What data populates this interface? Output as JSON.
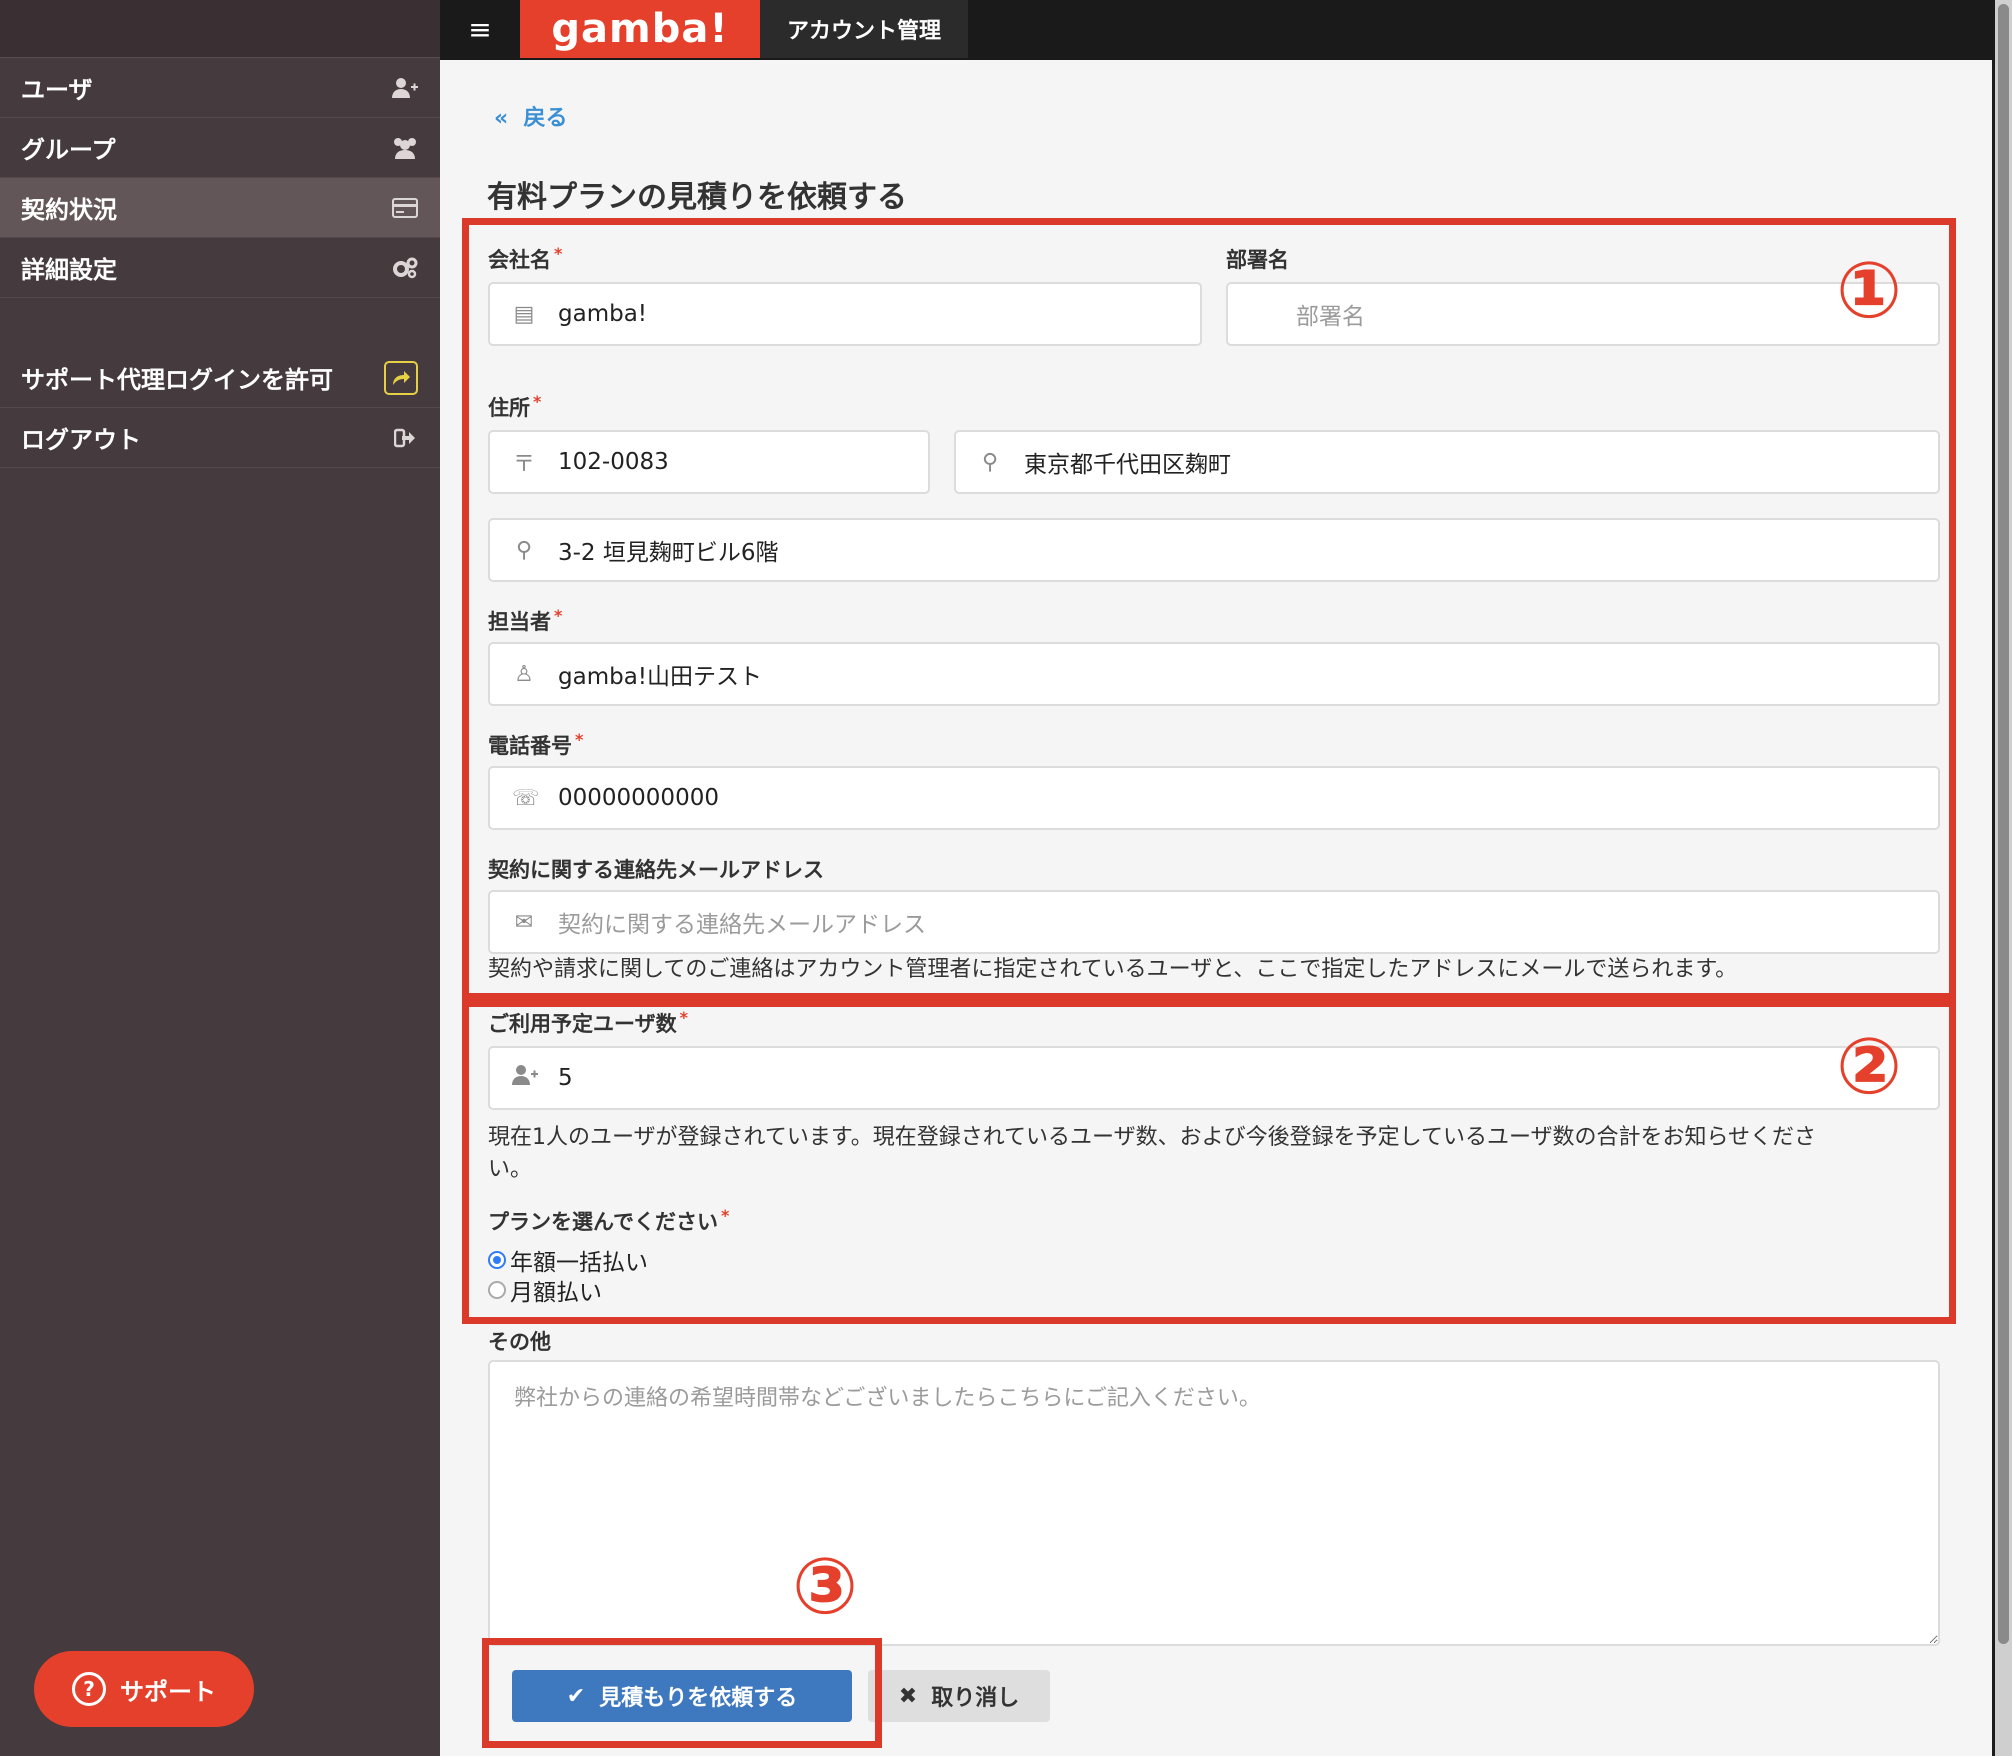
{
  "app": {
    "logo": "gamba!",
    "page_tab": "アカウント管理",
    "menu_icon": "hamburger-icon"
  },
  "sidebar": {
    "items": [
      {
        "label": "ユーザ",
        "icon": "add-user-icon"
      },
      {
        "label": "グループ",
        "icon": "group-icon"
      },
      {
        "label": "契約状況",
        "icon": "credit-card-icon",
        "active": true
      },
      {
        "label": "詳細設定",
        "icon": "gears-icon"
      },
      {
        "label": "サポート代理ログインを許可",
        "icon": "share-icon"
      },
      {
        "label": "ログアウト",
        "icon": "logout-icon"
      }
    ],
    "support_button": "サポート"
  },
  "back_link": "戻る",
  "page_title": "有料プランの見積りを依頼する",
  "form": {
    "company_label": "会社名",
    "company_value": "gamba!",
    "department_label": "部署名",
    "department_placeholder": "部署名",
    "address_label": "住所",
    "postal_value": "102-0083",
    "address1_value": "東京都千代田区麹町",
    "address2_value": "3-2 垣見麹町ビル6階",
    "contact_label": "担当者",
    "contact_value": "gamba!山田テスト",
    "phone_label": "電話番号",
    "phone_value": "00000000000",
    "email_label": "契約に関する連絡先メールアドレス",
    "email_placeholder": "契約に関する連絡先メールアドレス",
    "email_help": "契約や請求に関してのご連絡はアカウント管理者に指定されているユーザと、ここで指定したアドレスにメールで送られます。",
    "users_label": "ご利用予定ユーザ数",
    "users_value": "5",
    "users_help_line1": "現在1人のユーザが登録されています。現在登録されているユーザ数、および今後登録を予定しているユーザ数の合計をお知らせくださ",
    "users_help_line2": "い。",
    "plan_label": "プランを選んでください",
    "plan_options": [
      "年額一括払い",
      "月額払い"
    ],
    "plan_selected": "年額一括払い",
    "other_label": "その他",
    "other_placeholder": "弊社からの連絡の希望時間帯などございましたらこちらにご記入ください。",
    "submit_label": "見積もりを依頼する",
    "cancel_label": "取り消し"
  },
  "annotations": {
    "n1": "①",
    "n2": "②",
    "n3": "③"
  },
  "colors": {
    "accent": "#e5402c",
    "primary": "#3e78bf",
    "sidebar": "#453a3d",
    "link": "#3b8fd3"
  }
}
